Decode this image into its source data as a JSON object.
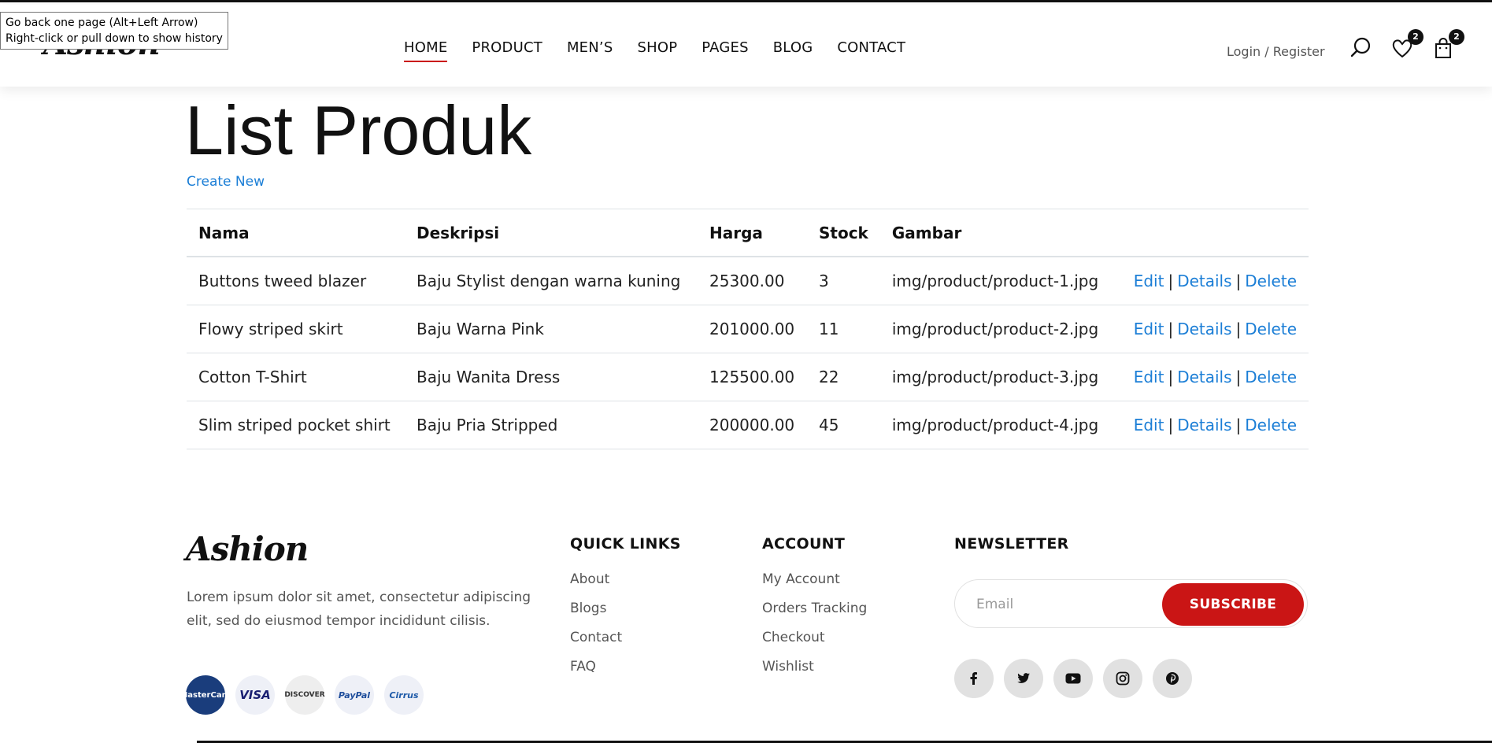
{
  "tooltip": {
    "line1": "Go back one page (Alt+Left Arrow)",
    "line2": "Right-click or pull down to show history"
  },
  "header": {
    "logo": "Ashion",
    "nav": [
      "HOME",
      "PRODUCT",
      "MEN’S",
      "SHOP",
      "PAGES",
      "BLOG",
      "CONTACT"
    ],
    "active_nav": "HOME",
    "login": "Login / Register",
    "wishlist_count": "2",
    "cart_count": "2",
    "icons": [
      "search-icon",
      "heart-icon",
      "bag-icon"
    ]
  },
  "main": {
    "title": "List Produk",
    "create_new": "Create New",
    "columns": [
      "Nama",
      "Deskripsi",
      "Harga",
      "Stock",
      "Gambar"
    ],
    "rows": [
      {
        "nama": "Buttons tweed blazer",
        "deskripsi": "Baju Stylist dengan warna kuning",
        "harga": "25300.00",
        "stock": "3",
        "gambar": "img/product/product-1.jpg"
      },
      {
        "nama": "Flowy striped skirt",
        "deskripsi": "Baju Warna Pink",
        "harga": "201000.00",
        "stock": "11",
        "gambar": "img/product/product-2.jpg"
      },
      {
        "nama": "Cotton T-Shirt",
        "deskripsi": "Baju Wanita Dress",
        "harga": "125500.00",
        "stock": "22",
        "gambar": "img/product/product-3.jpg"
      },
      {
        "nama": "Slim striped pocket shirt",
        "deskripsi": "Baju Pria Stripped",
        "harga": "200000.00",
        "stock": "45",
        "gambar": "img/product/product-4.jpg"
      }
    ],
    "actions": {
      "edit": "Edit",
      "details": "Details",
      "delete": "Delete",
      "separator": "|"
    }
  },
  "footer": {
    "logo": "Ashion",
    "description": "Lorem ipsum dolor sit amet, consectetur adipiscing elit, sed do eiusmod tempor incididunt cilisis.",
    "payments": [
      "MasterCard",
      "VISA",
      "DISCOVER",
      "PayPal",
      "Cirrus"
    ],
    "quick_links": {
      "title": "QUICK LINKS",
      "items": [
        "About",
        "Blogs",
        "Contact",
        "FAQ"
      ]
    },
    "account": {
      "title": "ACCOUNT",
      "items": [
        "My Account",
        "Orders Tracking",
        "Checkout",
        "Wishlist"
      ]
    },
    "newsletter": {
      "title": "NEWSLETTER",
      "placeholder": "Email",
      "button": "SUBSCRIBE"
    },
    "socials": [
      "facebook-icon",
      "twitter-icon",
      "youtube-icon",
      "instagram-icon",
      "pinterest-icon"
    ]
  },
  "colors": {
    "accent": "#ca1515",
    "link": "#1b7ed6",
    "text": "#111111",
    "muted": "#555555"
  }
}
